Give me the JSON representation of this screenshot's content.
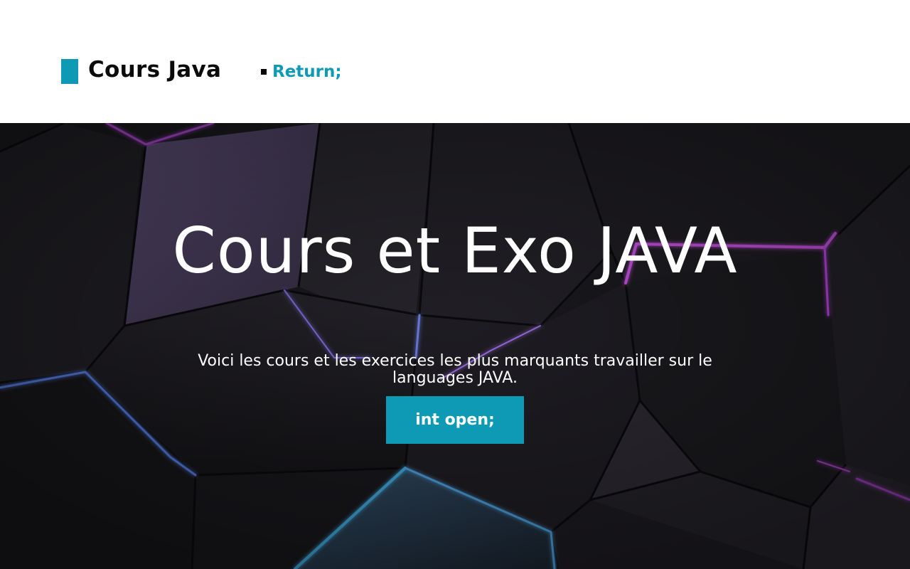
{
  "header": {
    "logo_text": "Cours Java",
    "nav_link_label": "Return;"
  },
  "hero": {
    "title": "Cours et Exo JAVA",
    "subtitle": "Voici les cours et les exercices les plus marquants travailler sur le languages JAVA.",
    "cta_label": "int open;"
  },
  "colors": {
    "accent": "#0e9ab5",
    "hero_background": "#1b1a1f",
    "glow_purple": "#d24dff",
    "glow_blue": "#4fb3ff"
  }
}
